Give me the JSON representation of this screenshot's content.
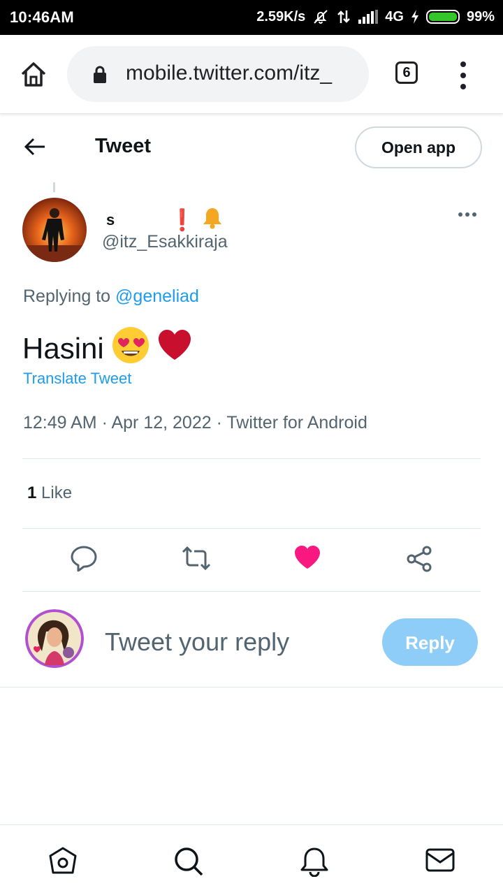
{
  "status_bar": {
    "time": "10:46AM",
    "net_speed": "2.59K/s",
    "network_type": "4G",
    "battery": "99%"
  },
  "browser": {
    "url": "mobile.twitter.com/itz_",
    "tab_count": "6"
  },
  "header": {
    "title": "Tweet",
    "open_app_label": "Open app"
  },
  "tweet": {
    "author_name": "s",
    "author_name_suffix": "❗",
    "author_handle": "@itz_Esakkiraja",
    "replying_prefix": "Replying to",
    "replying_mention": "@geneliad",
    "text": "Hasini",
    "text_emojis": [
      "heart-eyes",
      "red-heart"
    ],
    "translate_label": "Translate Tweet",
    "timestamp": "12:49 AM · Apr 12, 2022 · Twitter for Android",
    "like_count": "1",
    "like_label": "Like"
  },
  "reply": {
    "placeholder": "Tweet your reply",
    "button_label": "Reply"
  },
  "colors": {
    "accent": "#1d9bf0",
    "like": "#f91880",
    "reply_button": "#8ecdf8",
    "secondary_text": "#536471"
  },
  "icons": [
    "home-icon",
    "lock-icon",
    "menu-icon",
    "back-arrow-icon",
    "more-icon",
    "reply-icon",
    "retweet-icon",
    "like-icon",
    "share-icon",
    "nav-home-icon",
    "nav-search-icon",
    "nav-notifications-icon",
    "nav-messages-icon"
  ]
}
